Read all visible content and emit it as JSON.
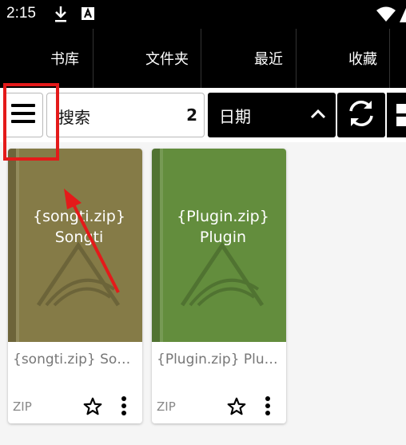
{
  "status_bar": {
    "time": "2:15"
  },
  "tabs": [
    {
      "label": "书库"
    },
    {
      "label": "文件夹"
    },
    {
      "label": "最近"
    },
    {
      "label": "收藏"
    }
  ],
  "toolbar": {
    "search_label": "搜索",
    "search_count": "2",
    "sort_label": "日期"
  },
  "books": [
    {
      "cover_title": "{songti.zip}",
      "cover_subtitle": "Songti",
      "title": "{songti.zip} Songti",
      "format": "ZIP",
      "cover_color": "#857b47"
    },
    {
      "cover_title": "{Plugin.zip}",
      "cover_subtitle": "Plugin",
      "title": "{Plugin.zip} Plugin",
      "format": "ZIP",
      "cover_color": "#638d3d"
    }
  ],
  "colors": {
    "annotation": "#e41a1a",
    "bar_background": "#000000"
  }
}
